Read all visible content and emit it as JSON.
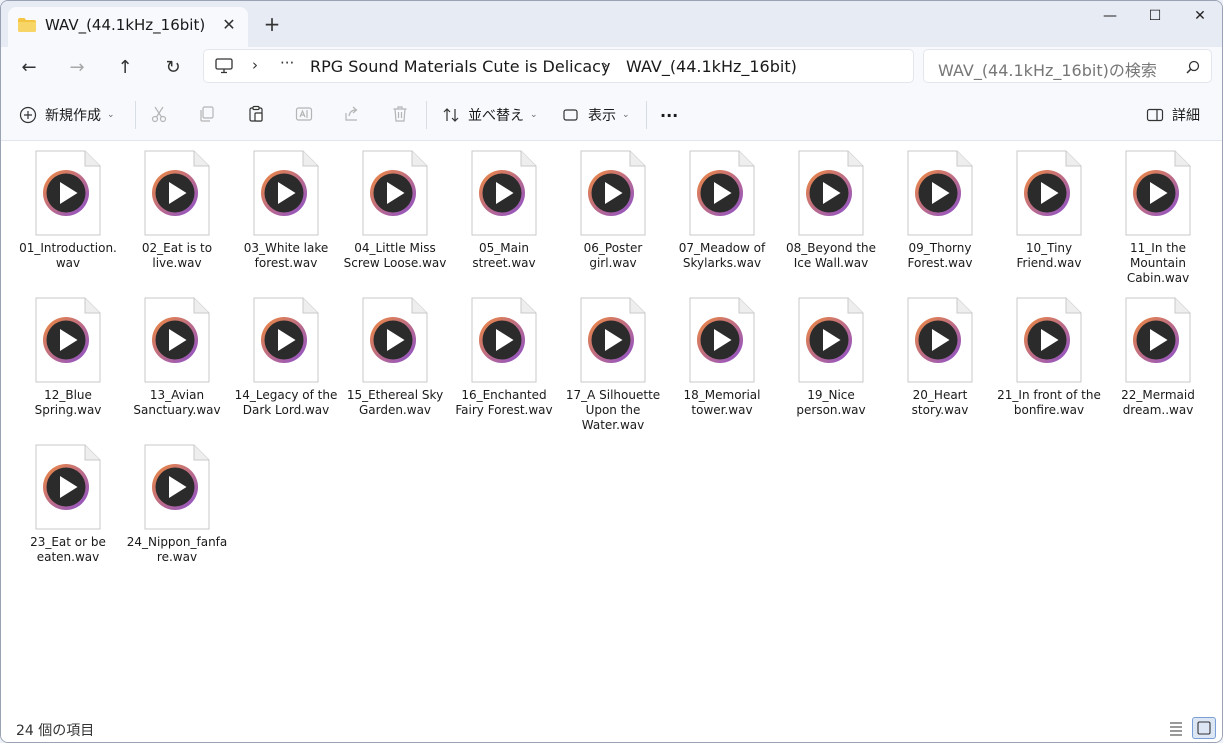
{
  "window": {
    "tab_title": "WAV_(44.1kHz_16bit)",
    "tab_close": "✕",
    "new_tab": "+",
    "minimize": "—",
    "maximize": "☐",
    "close": "✕"
  },
  "nav": {
    "back": "←",
    "forward": "→",
    "up": "↑",
    "refresh": "↻"
  },
  "address": {
    "separator": "›",
    "ellipsis": "···",
    "crumbs": [
      "RPG Sound Materials Cute is Delicacy",
      "WAV_(44.1kHz_16bit)"
    ]
  },
  "search": {
    "placeholder": "WAV_(44.1kHz_16bit)の検索"
  },
  "toolbar": {
    "new_label": "新規作成",
    "sort_label": "並べ替え",
    "view_label": "表示",
    "more_label": "···",
    "details_label": "詳細",
    "caret": "⌄"
  },
  "files": [
    "01_Introduction.wav",
    "02_Eat is to live.wav",
    "03_White lake forest.wav",
    "04_Little Miss Screw Loose.wav",
    "05_Main street.wav",
    "06_Poster girl.wav",
    "07_Meadow of Skylarks.wav",
    "08_Beyond the Ice Wall.wav",
    "09_Thorny Forest.wav",
    "10_Tiny Friend.wav",
    "11_In the Mountain Cabin.wav",
    "12_Blue Spring.wav",
    "13_Avian Sanctuary.wav",
    "14_Legacy of the Dark Lord.wav",
    "15_Ethereal Sky Garden.wav",
    "16_Enchanted Fairy Forest.wav",
    "17_A Silhouette Upon the Water.wav",
    "18_Memorial tower.wav",
    "19_Nice person.wav",
    "20_Heart story.wav",
    "21_In front of the bonfire.wav",
    "22_Mermaid dream..wav",
    "23_Eat or be eaten.wav",
    "24_Nippon_fanfare.wav"
  ],
  "status": {
    "count_text": "24 個の項目"
  },
  "colors": {
    "accent": "#2f6fd3",
    "folder": "#f4c542",
    "play_ring_start": "#f08a3c",
    "play_ring_end": "#8a4fd0"
  }
}
